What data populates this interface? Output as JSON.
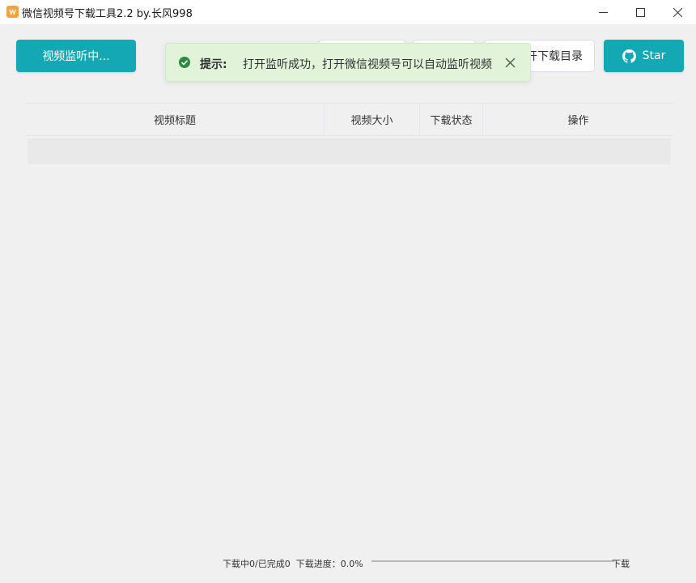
{
  "window": {
    "title": "微信视频号下载工具2.2 by.长风998",
    "app_icon": "app-logo-icon",
    "controls": [
      "minimize-icon",
      "maximize-icon",
      "close-icon"
    ]
  },
  "toolbar": {
    "listen_button": "视频监听中...",
    "open_dir_button": "打开下载目录",
    "star_button": "Star",
    "star_icon": "github-icon",
    "accent_color": "#13a8b4"
  },
  "toast": {
    "title": "提示:",
    "message": "打开监听成功，打开微信视频号可以自动监听视频",
    "icon": "check-circle-icon",
    "background": "#e1f3d8"
  },
  "table": {
    "columns": [
      "视频标题",
      "视频大小",
      "下载状态",
      "操作"
    ],
    "rows": []
  },
  "footer": {
    "status": "下载中0/已完成0",
    "progress_label": "下载进度：0.0%",
    "progress": 0.0,
    "right_label": "下载"
  }
}
